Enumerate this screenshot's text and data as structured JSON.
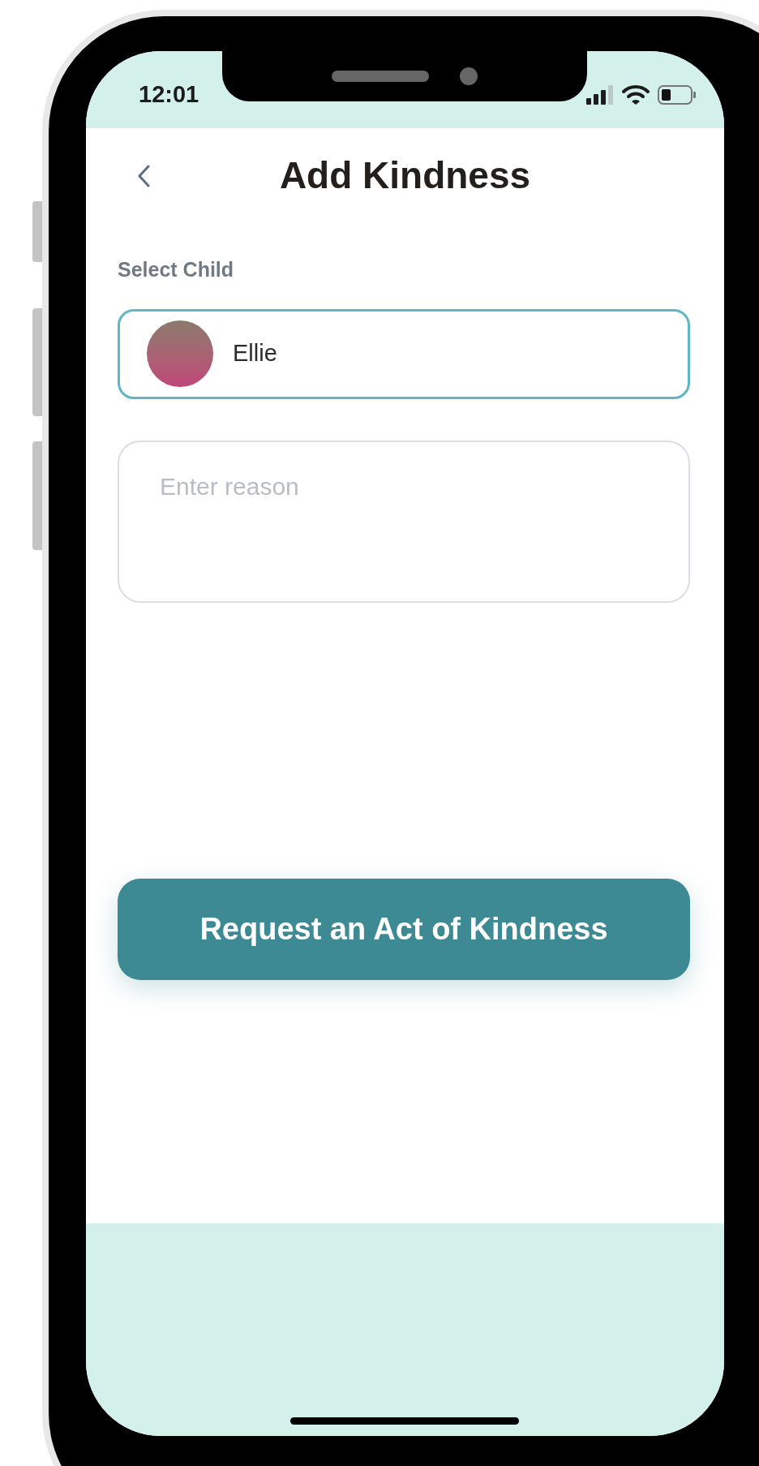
{
  "status_bar": {
    "time": "12:01"
  },
  "header": {
    "title": "Add Kindness"
  },
  "child_select": {
    "label": "Select Child",
    "value": "Ellie"
  },
  "reason": {
    "placeholder": "Enter reason"
  },
  "submit_button": {
    "label": "Request an Act of Kindness"
  }
}
